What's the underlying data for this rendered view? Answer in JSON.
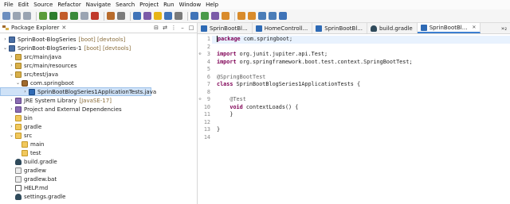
{
  "menu": [
    "File",
    "Edit",
    "Source",
    "Refactor",
    "Navigate",
    "Search",
    "Project",
    "Run",
    "Window",
    "Help"
  ],
  "toolbar": {
    "colors": [
      "#6c8ebf",
      "#9aa4b2",
      "#9aa4b2",
      "#5a9b3a",
      "#2d7d2d",
      "#c25b2a",
      "#3a8a3a",
      "#9aa4b2",
      "#c0392b",
      "#b86b2b",
      "#7a7a7a",
      "#3f73b8",
      "#7b5ba8",
      "#e7b416",
      "#3f73b8",
      "#7a7a7a",
      "#3f73b8",
      "#4a9a4a",
      "#7b5ba8",
      "#d98b2b",
      "#d98b2b",
      "#d98b2b",
      "#4a7db8",
      "#4a7db8",
      "#3f73b8"
    ]
  },
  "explorer": {
    "title": "Package Explorer",
    "close": "✕",
    "tree": [
      {
        "arrow": "›",
        "icon": "project",
        "label": "SprinBoot-BlogSeries",
        "decor": "[boot] [devtools]",
        "indent": 0
      },
      {
        "arrow": "⌄",
        "icon": "project",
        "label": "SprinBoot-BlogSeries-1",
        "decor": "[boot] [devtools]",
        "indent": 0
      },
      {
        "arrow": "›",
        "icon": "src",
        "label": "src/main/java",
        "decor": "",
        "indent": 1
      },
      {
        "arrow": "›",
        "icon": "src",
        "label": "src/main/resources",
        "decor": "",
        "indent": 1
      },
      {
        "arrow": "⌄",
        "icon": "src",
        "label": "src/test/java",
        "decor": "",
        "indent": 1
      },
      {
        "arrow": "⌄",
        "icon": "pkg",
        "label": "com.springboot",
        "decor": "",
        "indent": 2
      },
      {
        "arrow": "›",
        "icon": "java",
        "label": "SprinBootBlogSeries1ApplicationTests.java",
        "decor": "",
        "indent": 3,
        "selected": true
      },
      {
        "arrow": "›",
        "icon": "lib",
        "label": "JRE System Library",
        "decor": "[JavaSE-17]",
        "indent": 1
      },
      {
        "arrow": "›",
        "icon": "lib",
        "label": "Project and External Dependencies",
        "decor": "",
        "indent": 1
      },
      {
        "arrow": "",
        "icon": "folder",
        "label": "bin",
        "decor": "",
        "indent": 1
      },
      {
        "arrow": "›",
        "icon": "folder",
        "label": "gradle",
        "decor": "",
        "indent": 1
      },
      {
        "arrow": "⌄",
        "icon": "folder",
        "label": "src",
        "decor": "",
        "indent": 1
      },
      {
        "arrow": "",
        "icon": "folder",
        "label": "main",
        "decor": "",
        "indent": 2
      },
      {
        "arrow": "",
        "icon": "folder",
        "label": "test",
        "decor": "",
        "indent": 2
      },
      {
        "arrow": "",
        "icon": "gradle",
        "label": "build.gradle",
        "decor": "",
        "indent": 1
      },
      {
        "arrow": "",
        "icon": "file",
        "label": "gradlew",
        "decor": "",
        "indent": 1
      },
      {
        "arrow": "",
        "icon": "file",
        "label": "gradlew.bat",
        "decor": "",
        "indent": 1
      },
      {
        "arrow": "",
        "icon": "md",
        "label": "HELP.md",
        "decor": "",
        "indent": 1
      },
      {
        "arrow": "",
        "icon": "gradle",
        "label": "settings.gradle",
        "decor": "",
        "indent": 1
      }
    ]
  },
  "editor": {
    "tabs": [
      {
        "icon": "j",
        "label": "SprinBootBl..."
      },
      {
        "icon": "j",
        "label": "HomeControll..."
      },
      {
        "icon": "j",
        "label": "SprinBootBl..."
      },
      {
        "icon": "g",
        "label": "build.gradle"
      },
      {
        "icon": "j",
        "label": "SprinBootBl...",
        "active": true
      }
    ],
    "tab_close": "✕",
    "overflow": "»₂",
    "lines": [
      {
        "n": "1",
        "fold": "",
        "parts": [
          {
            "t": "package",
            "c": "kw"
          },
          {
            "t": " com.springboot;",
            "c": ""
          }
        ]
      },
      {
        "n": "2",
        "fold": "",
        "parts": []
      },
      {
        "n": "3",
        "fold": "⊕",
        "parts": [
          {
            "t": "import",
            "c": "kw"
          },
          {
            "t": " org.junit.jupiter.api.Test;",
            "c": ""
          }
        ]
      },
      {
        "n": "4",
        "fold": "",
        "parts": [
          {
            "t": "import",
            "c": "kw"
          },
          {
            "t": " org.springframework.boot.test.context.SpringBootTest;",
            "c": ""
          }
        ]
      },
      {
        "n": "5",
        "fold": "",
        "parts": []
      },
      {
        "n": "6",
        "fold": "",
        "parts": [
          {
            "t": "@SpringBootTest",
            "c": "ann"
          }
        ]
      },
      {
        "n": "7",
        "fold": "",
        "parts": [
          {
            "t": "class",
            "c": "kw"
          },
          {
            "t": " SprinBootBlogSeries1ApplicationTests {",
            "c": ""
          }
        ]
      },
      {
        "n": "8",
        "fold": "",
        "parts": []
      },
      {
        "n": "9",
        "fold": "⊖",
        "parts": [
          {
            "t": "    ",
            "c": ""
          },
          {
            "t": "@Test",
            "c": "ann"
          }
        ]
      },
      {
        "n": "10",
        "fold": "",
        "parts": [
          {
            "t": "    ",
            "c": ""
          },
          {
            "t": "void",
            "c": "kw"
          },
          {
            "t": " contextLoads() {",
            "c": ""
          }
        ]
      },
      {
        "n": "11",
        "fold": "",
        "parts": [
          {
            "t": "    }",
            "c": ""
          }
        ]
      },
      {
        "n": "12",
        "fold": "",
        "parts": []
      },
      {
        "n": "13",
        "fold": "",
        "parts": [
          {
            "t": "}",
            "c": ""
          }
        ]
      },
      {
        "n": "14",
        "fold": "",
        "parts": []
      }
    ]
  }
}
